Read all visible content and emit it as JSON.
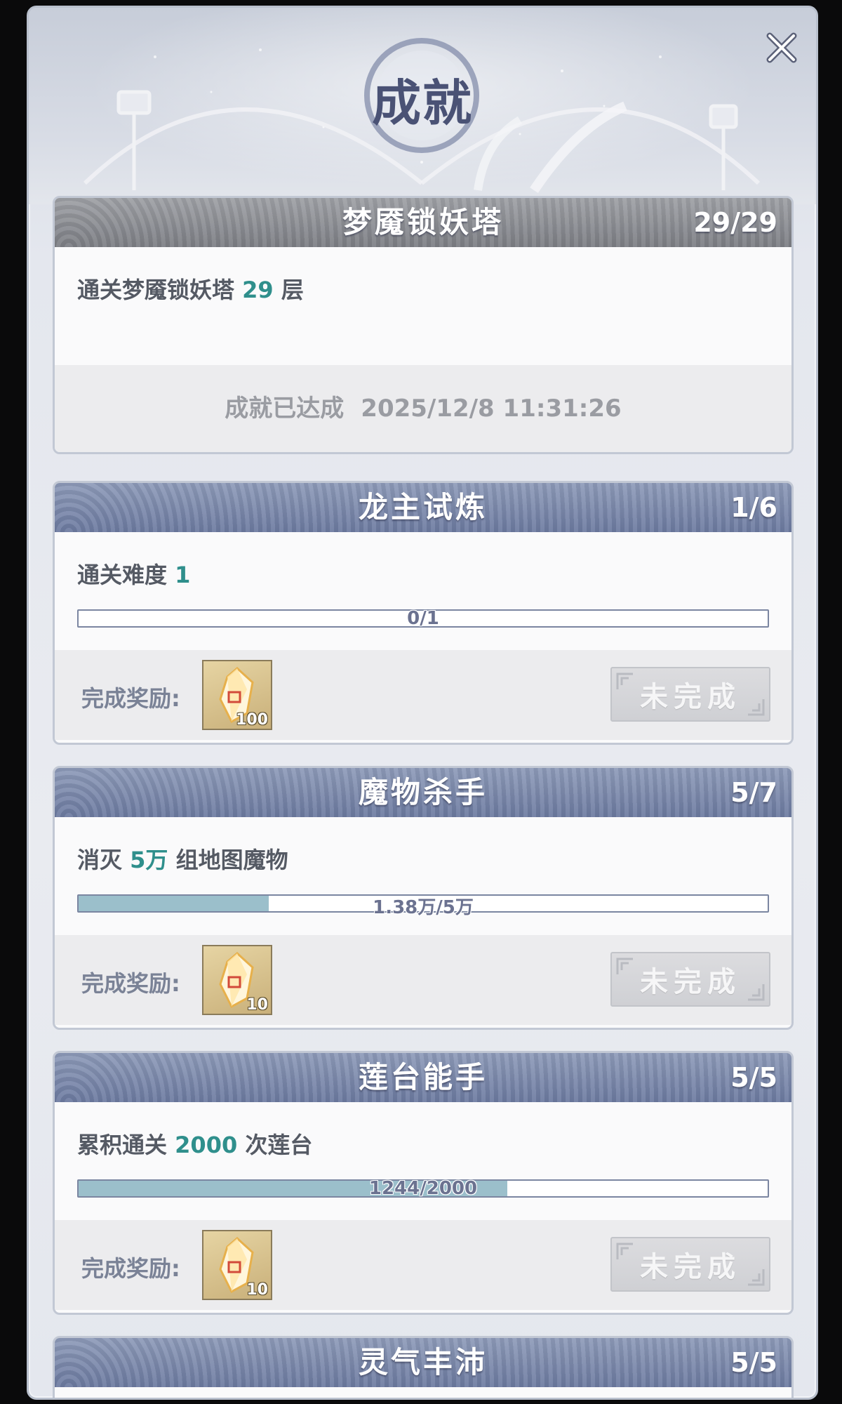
{
  "page": {
    "title": "成就"
  },
  "cards": [
    {
      "title": "梦魇锁妖塔",
      "count": "29/29",
      "desc_prefix": "通关梦魇锁妖塔 ",
      "desc_num": "29",
      "desc_suffix": " 层",
      "completed_label": "成就已达成",
      "completed_time": "2025/12/8 11:31:26"
    },
    {
      "title": "龙主试炼",
      "count": "1/6",
      "desc_prefix": "通关难度 ",
      "desc_num": "1",
      "desc_suffix": "",
      "progress_text": "0/1",
      "progress_fraction": 0.0,
      "reward_label": "完成奖励:",
      "reward_qty": "100",
      "status": "未完成"
    },
    {
      "title": "魔物杀手",
      "count": "5/7",
      "desc_prefix": "消灭 ",
      "desc_num": "5万",
      "desc_suffix": " 组地图魔物",
      "progress_text": "1.38万/5万",
      "progress_fraction": 0.276,
      "reward_label": "完成奖励:",
      "reward_qty": "10",
      "status": "未完成"
    },
    {
      "title": "莲台能手",
      "count": "5/5",
      "desc_prefix": "累积通关 ",
      "desc_num": "2000",
      "desc_suffix": " 次莲台",
      "progress_text": "1244/2000",
      "progress_fraction": 0.622,
      "reward_label": "完成奖励:",
      "reward_qty": "10",
      "status": "未完成"
    },
    {
      "title": "灵气丰沛",
      "count": "5/5"
    }
  ],
  "colors": {
    "header_active": "#6c7aa0",
    "header_done": "#7c7e84",
    "highlight_number": "#2f8f8c",
    "progress_fill": "#9bbfcb"
  },
  "icons": {
    "close": "close-icon",
    "reward": "gem-crystal-icon"
  }
}
